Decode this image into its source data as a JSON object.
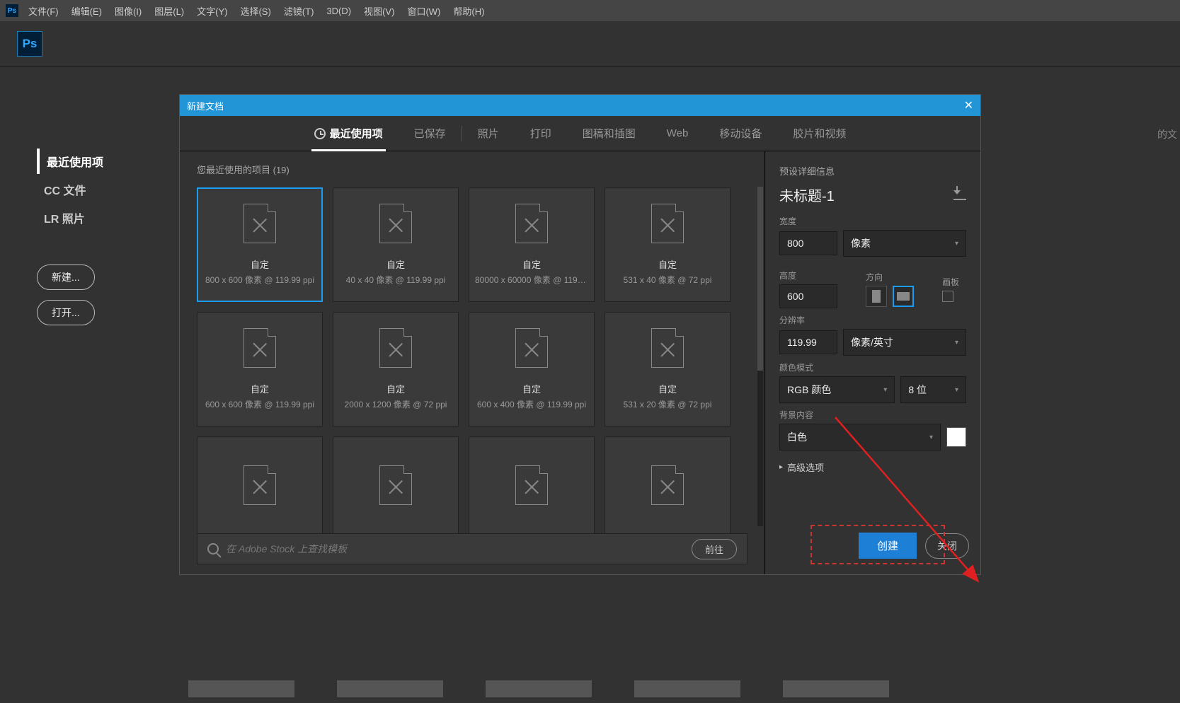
{
  "menubar": {
    "items": [
      "文件(F)",
      "编辑(E)",
      "图像(I)",
      "图层(L)",
      "文字(Y)",
      "选择(S)",
      "滤镜(T)",
      "3D(D)",
      "视图(V)",
      "窗口(W)",
      "帮助(H)"
    ],
    "app_short": "Ps"
  },
  "start_sidebar": {
    "items": [
      {
        "label": "最近使用项",
        "active": true
      },
      {
        "label": "CC 文件",
        "active": false
      },
      {
        "label": "LR 照片",
        "active": false
      }
    ],
    "new_btn": "新建...",
    "open_btn": "打开..."
  },
  "dialog": {
    "title": "新建文档",
    "tabs": [
      "最近使用项",
      "已保存",
      "照片",
      "打印",
      "图稿和插图",
      "Web",
      "移动设备",
      "胶片和视频"
    ],
    "active_tab": 0,
    "recent_header": "您最近使用的项目  (19)",
    "stock_placeholder": "在 Adobe Stock 上查找模板",
    "stock_go": "前往",
    "presets": [
      {
        "name": "自定",
        "spec": "800 x 600 像素 @ 119.99 ppi",
        "selected": true
      },
      {
        "name": "自定",
        "spec": "40 x 40 像素 @ 119.99 ppi"
      },
      {
        "name": "自定",
        "spec": "80000 x 60000 像素 @ 119.9..."
      },
      {
        "name": "自定",
        "spec": "531 x 40 像素 @ 72 ppi"
      },
      {
        "name": "自定",
        "spec": "600 x 600 像素 @ 119.99 ppi"
      },
      {
        "name": "自定",
        "spec": "2000 x 1200 像素 @ 72 ppi"
      },
      {
        "name": "自定",
        "spec": "600 x 400 像素 @ 119.99 ppi"
      },
      {
        "name": "自定",
        "spec": "531 x 20 像素 @ 72 ppi"
      },
      {
        "name": "",
        "spec": ""
      },
      {
        "name": "",
        "spec": ""
      },
      {
        "name": "",
        "spec": ""
      },
      {
        "name": "",
        "spec": ""
      }
    ]
  },
  "details": {
    "header": "预设详细信息",
    "doc_name": "未标题-1",
    "width_label": "宽度",
    "width_value": "800",
    "width_unit": "像素",
    "height_label": "高度",
    "height_value": "600",
    "orient_label": "方向",
    "artboard_label": "画板",
    "res_label": "分辨率",
    "res_value": "119.99",
    "res_unit": "像素/英寸",
    "mode_label": "颜色模式",
    "mode_value": "RGB 颜色",
    "depth_value": "8 位",
    "bg_label": "背景内容",
    "bg_value": "白色",
    "advanced": "高级选项",
    "create_btn": "创建",
    "close_btn": "关闭"
  },
  "edge_text": "的文"
}
